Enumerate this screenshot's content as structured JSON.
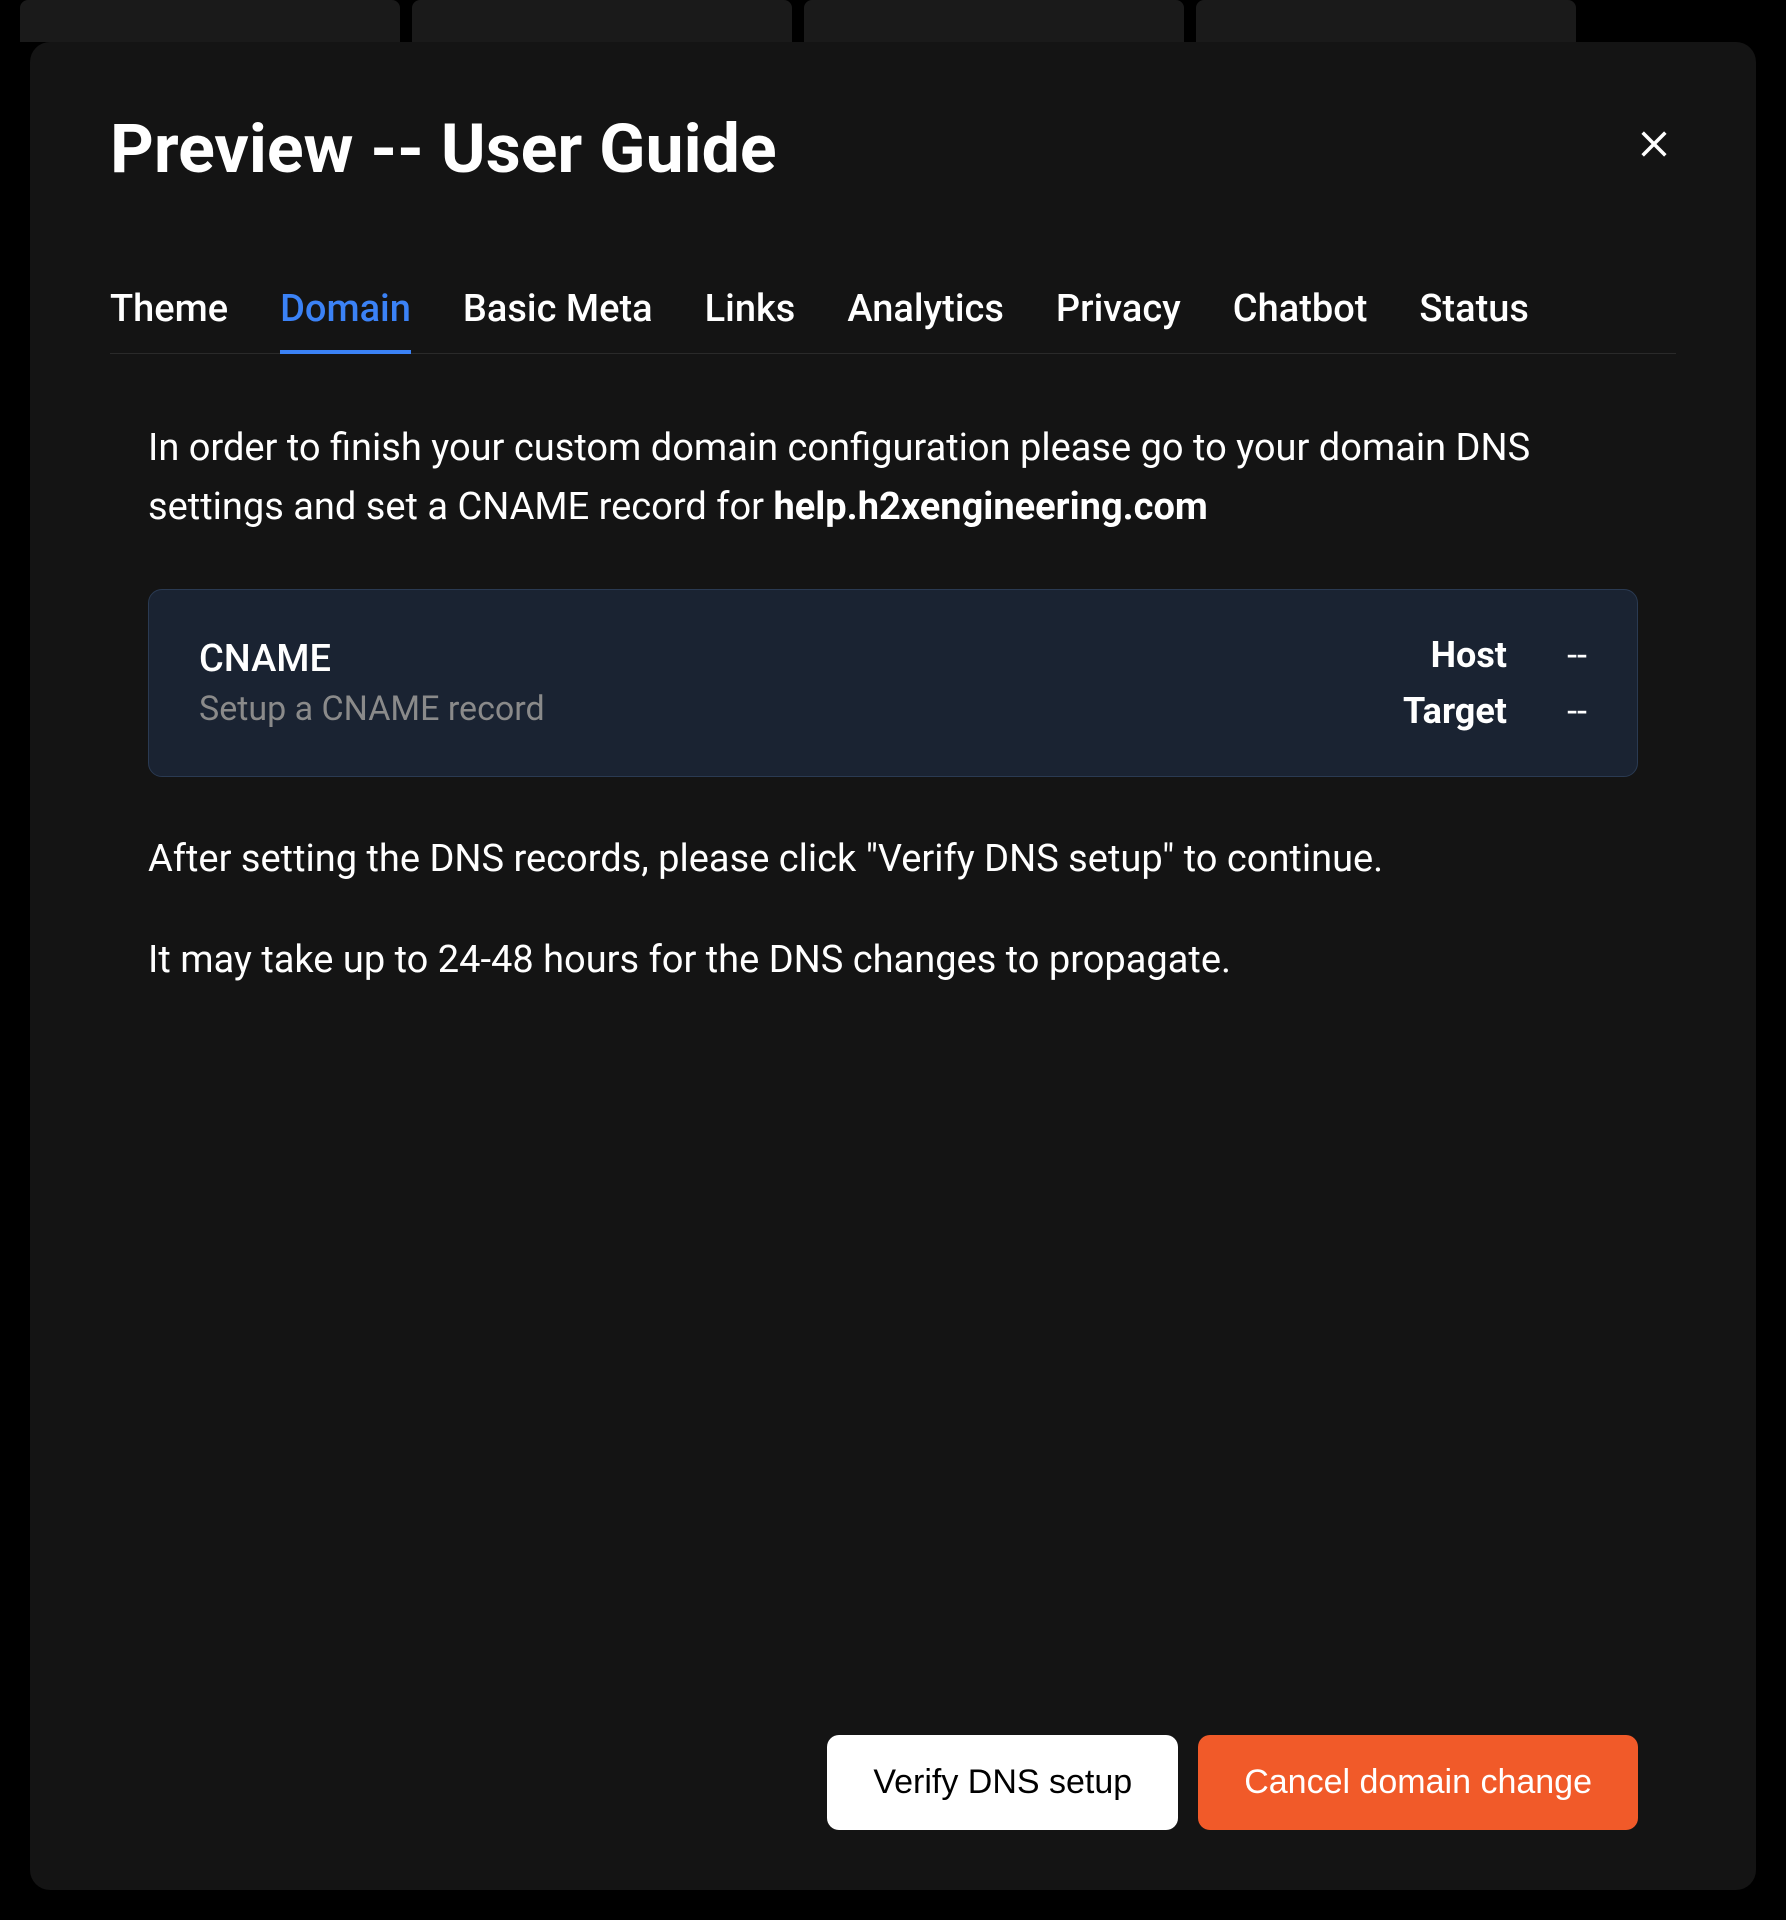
{
  "modal": {
    "title": "Preview -- User Guide"
  },
  "tabs": [
    {
      "label": "Theme",
      "active": false
    },
    {
      "label": "Domain",
      "active": true
    },
    {
      "label": "Basic Meta",
      "active": false
    },
    {
      "label": "Links",
      "active": false
    },
    {
      "label": "Analytics",
      "active": false
    },
    {
      "label": "Privacy",
      "active": false
    },
    {
      "label": "Chatbot",
      "active": false
    },
    {
      "label": "Status",
      "active": false
    }
  ],
  "domain": {
    "instruction_prefix": "In order to finish your custom domain configuration please go to your domain DNS settings and set a CNAME record for ",
    "domain_name": "help.h2xengineering.com",
    "cname": {
      "title": "CNAME",
      "subtitle": "Setup a CNAME record",
      "host_label": "Host",
      "host_value": "--",
      "target_label": "Target",
      "target_value": "--"
    },
    "post_instruction_1": "After setting the DNS records, please click \"Verify DNS setup\" to continue.",
    "post_instruction_2": "It may take up to 24-48 hours for the DNS changes to propagate."
  },
  "footer": {
    "verify_label": "Verify DNS setup",
    "cancel_label": "Cancel domain change"
  }
}
